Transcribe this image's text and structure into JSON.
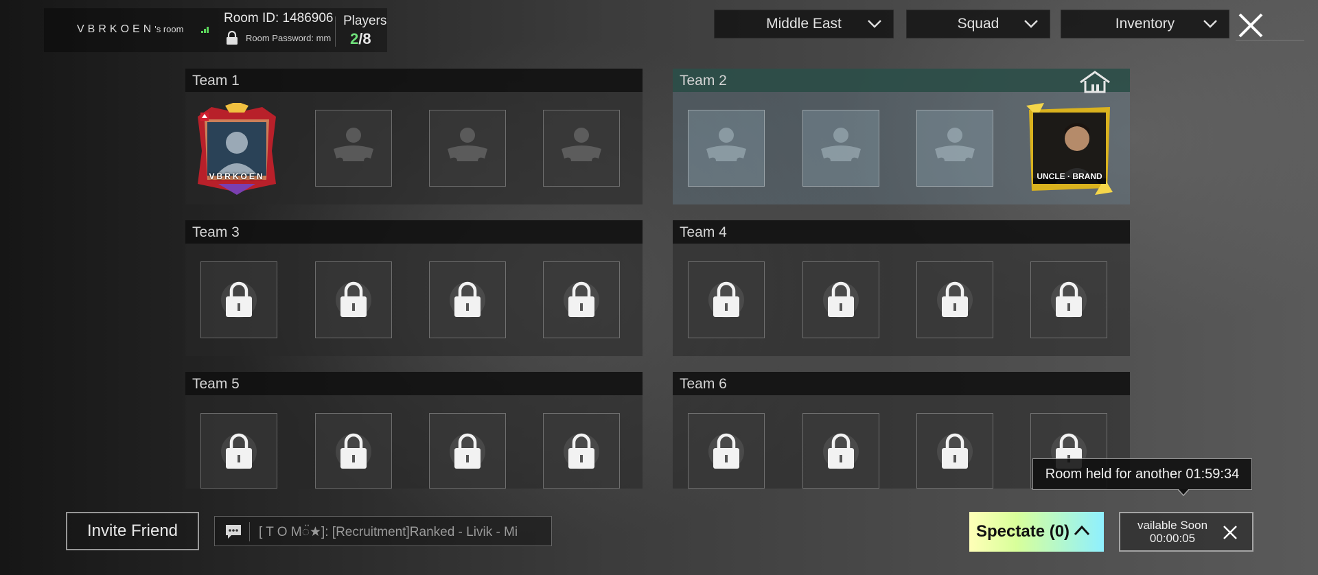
{
  "room": {
    "owner": "VBRKOEN",
    "owner_suffix": "'s room",
    "room_id": "Room ID: 1486906",
    "password": "Room Password: mm",
    "players_label": "Players",
    "players_current": "2",
    "players_total": "/8"
  },
  "filters": {
    "region": "Middle East",
    "mode": "Squad",
    "inventory": "Inventory"
  },
  "teams": [
    {
      "label": "Team 1"
    },
    {
      "label": "Team 2"
    },
    {
      "label": "Team 3"
    },
    {
      "label": "Team 4"
    },
    {
      "label": "Team 5"
    },
    {
      "label": "Team 6"
    }
  ],
  "players": {
    "team1_slot1": "VBRKOEN",
    "team2_slot4": "UNCLE · BRAND"
  },
  "bottom": {
    "invite_label": "Invite Friend",
    "chat_message": "[ T O M◌̈★]: [Recruitment]Ranked - Livik - Mi",
    "room_held": "Room held for another 01:59:34",
    "spectate_label": "Spectate (0)",
    "available_line1": "vailable Soon",
    "available_line2": "00:00:05"
  },
  "colors": {
    "players_current": "#6fe07a",
    "spectate_gradient_start": "#ffffb8",
    "spectate_gradient_end": "#8ff0ff",
    "active_team_header": "#284b44"
  }
}
